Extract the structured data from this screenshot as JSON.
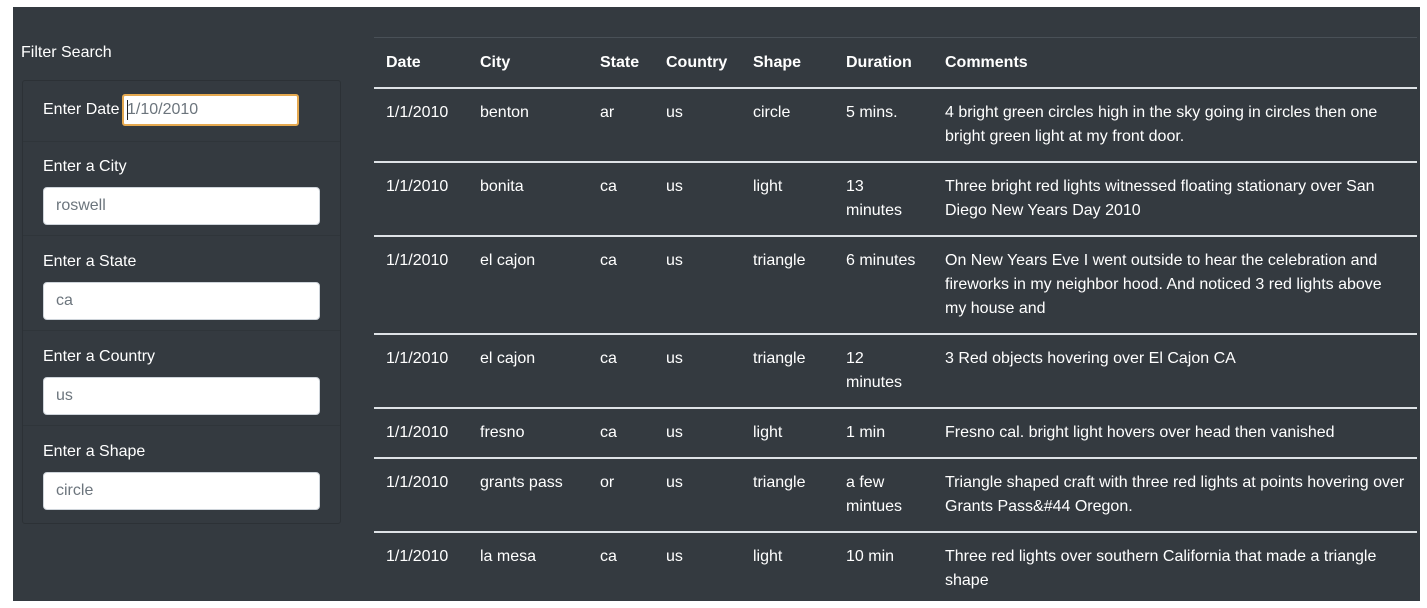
{
  "sidebar": {
    "title": "Filter Search",
    "filters": [
      {
        "label": "Enter Date",
        "value": "",
        "placeholder": "1/10/2010"
      },
      {
        "label": "Enter a City",
        "value": "",
        "placeholder": "roswell"
      },
      {
        "label": "Enter a State",
        "value": "",
        "placeholder": "ca"
      },
      {
        "label": "Enter a Country",
        "value": "",
        "placeholder": "us"
      },
      {
        "label": "Enter a Shape",
        "value": "",
        "placeholder": "circle"
      }
    ]
  },
  "table": {
    "columns": [
      "Date",
      "City",
      "State",
      "Country",
      "Shape",
      "Duration",
      "Comments"
    ],
    "rows": [
      [
        "1/1/2010",
        "benton",
        "ar",
        "us",
        "circle",
        "5 mins.",
        "4 bright green circles high in the sky going in circles then one bright green light at my front door."
      ],
      [
        "1/1/2010",
        "bonita",
        "ca",
        "us",
        "light",
        "13 minutes",
        "Three bright red lights witnessed floating stationary over San Diego New Years Day 2010"
      ],
      [
        "1/1/2010",
        "el cajon",
        "ca",
        "us",
        "triangle",
        "6 minutes",
        "On New Years Eve I went outside to hear the celebration and fireworks in my neighbor hood. And noticed 3 red lights above my house and"
      ],
      [
        "1/1/2010",
        "el cajon",
        "ca",
        "us",
        "triangle",
        "12 minutes",
        "3 Red objects hovering over El Cajon CA"
      ],
      [
        "1/1/2010",
        "fresno",
        "ca",
        "us",
        "light",
        "1 min",
        "Fresno cal. bright light hovers over head then vanished"
      ],
      [
        "1/1/2010",
        "grants pass",
        "or",
        "us",
        "triangle",
        "a few mintues",
        "Triangle shaped craft with three red lights at points hovering over Grants Pass&#44 Oregon."
      ],
      [
        "1/1/2010",
        "la mesa",
        "ca",
        "us",
        "light",
        "10 min",
        "Three red lights over southern California that made a triangle shape"
      ]
    ]
  },
  "colors": {
    "background": "#343a40",
    "text": "#ffffff",
    "row_divider": "#dee2e6",
    "focus_border": "#e5a950"
  }
}
